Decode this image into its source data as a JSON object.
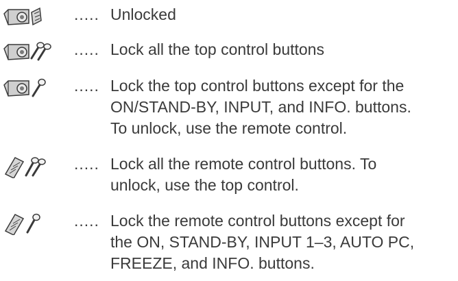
{
  "entries": [
    {
      "icon": "projector-unlocked-icon",
      "dots": ".....",
      "lines": [
        "Unlocked"
      ]
    },
    {
      "icon": "projector-double-key-icon",
      "dots": ".....",
      "lines": [
        "Lock all the top control buttons"
      ]
    },
    {
      "icon": "projector-single-key-icon",
      "dots": ".....",
      "lines": [
        "Lock the top control buttons except for the",
        "ON/STAND-BY, INPUT, and INFO. buttons.",
        "To unlock, use the remote control."
      ]
    },
    {
      "icon": "remote-double-key-icon",
      "dots": ".....",
      "lines": [
        "Lock all the remote control buttons. To",
        "unlock, use the top control."
      ]
    },
    {
      "icon": "remote-single-key-icon",
      "dots": ".....",
      "lines": [
        "Lock the remote control buttons except for",
        "the ON, STAND-BY, INPUT 1–3, AUTO PC,",
        "FREEZE, and INFO. buttons."
      ]
    }
  ]
}
